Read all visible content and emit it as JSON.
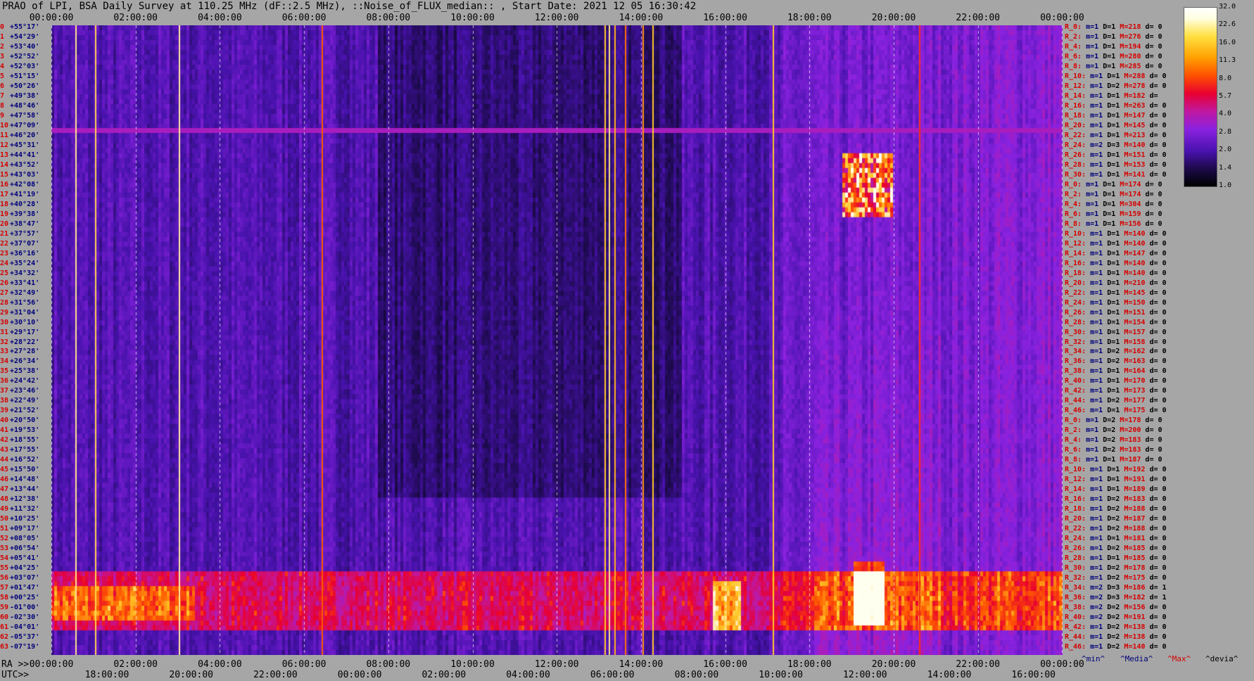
{
  "title": "PRAO of LPI, BSA Daily Survey at 110.25 MHz (dF::2.5 MHz), ::Noise_of_FLUX_median:: , Start Date: 2021 12 05 16:30:42",
  "top_axis": [
    "00:00:00",
    "02:00:00",
    "04:00:00",
    "06:00:00",
    "08:00:00",
    "10:00:00",
    "12:00:00",
    "14:00:00",
    "16:00:00",
    "18:00:00",
    "20:00:00",
    "22:00:00",
    "00:00:00"
  ],
  "ra_label": "RA >>",
  "utc_label": "UTC>>",
  "ra_axis": [
    "00:00:00",
    "02:00:00",
    "04:00:00",
    "06:00:00",
    "08:00:00",
    "10:00:00",
    "12:00:00",
    "14:00:00",
    "16:00:00",
    "18:00:00",
    "20:00:00",
    "22:00:00",
    "00:00:00"
  ],
  "utc_axis": [
    "18:00:00",
    "20:00:00",
    "22:00:00",
    "00:00:00",
    "02:00:00",
    "04:00:00",
    "06:00:00",
    "08:00:00",
    "10:00:00",
    "12:00:00",
    "14:00:00",
    "16:00:00"
  ],
  "colorbar": {
    "ticks": [
      "32.0",
      "22.6",
      "16.0",
      "11.3",
      "8.0",
      "5.7",
      "4.0",
      "2.8",
      "2.0",
      "1.4",
      "1.0"
    ]
  },
  "footer": {
    "min": "^min^",
    "media": "^Media^",
    "max": "^Max^",
    "devia": "^devia^"
  },
  "chart_data": {
    "type": "heatmap",
    "title": "PRAO of LPI, BSA Daily Survey at 110.25 MHz (dF::2.5 MHz), ::Noise_of_FLUX_median:: , Start Date: 2021 12 05 16:30:42",
    "x_top_ticks": [
      "00:00:00",
      "02:00:00",
      "04:00:00",
      "06:00:00",
      "08:00:00",
      "10:00:00",
      "12:00:00",
      "14:00:00",
      "16:00:00",
      "18:00:00",
      "20:00:00",
      "22:00:00",
      "00:00:00"
    ],
    "x_bottom_ra_ticks": [
      "00:00:00",
      "02:00:00",
      "04:00:00",
      "06:00:00",
      "08:00:00",
      "10:00:00",
      "12:00:00",
      "14:00:00",
      "16:00:00",
      "18:00:00",
      "20:00:00",
      "22:00:00",
      "00:00:00"
    ],
    "x_bottom_utc_ticks": [
      "18:00:00",
      "20:00:00",
      "22:00:00",
      "00:00:00",
      "02:00:00",
      "04:00:00",
      "06:00:00",
      "08:00:00",
      "10:00:00",
      "12:00:00",
      "14:00:00",
      "16:00:00"
    ],
    "colorbar_range": [
      1.0,
      32.0
    ],
    "rows": [
      {
        "n": "0",
        "dec": "+55°17'"
      },
      {
        "n": "1",
        "dec": "+54°29'"
      },
      {
        "n": "2",
        "dec": "+53°40'"
      },
      {
        "n": "3",
        "dec": "+52°52'"
      },
      {
        "n": "4",
        "dec": "+52°03'"
      },
      {
        "n": "5",
        "dec": "+51°15'"
      },
      {
        "n": "6",
        "dec": "+50°26'"
      },
      {
        "n": "7",
        "dec": "+49°38'"
      },
      {
        "n": "8",
        "dec": "+48°46'"
      },
      {
        "n": "9",
        "dec": "+47°58'"
      },
      {
        "n": "10",
        "dec": "+47°09'"
      },
      {
        "n": "11",
        "dec": "+46°20'"
      },
      {
        "n": "12",
        "dec": "+45°31'"
      },
      {
        "n": "13",
        "dec": "+44°41'"
      },
      {
        "n": "14",
        "dec": "+43°52'"
      },
      {
        "n": "15",
        "dec": "+43°03'"
      },
      {
        "n": "16",
        "dec": "+42°08'"
      },
      {
        "n": "17",
        "dec": "+41°19'"
      },
      {
        "n": "18",
        "dec": "+40°28'"
      },
      {
        "n": "19",
        "dec": "+39°38'"
      },
      {
        "n": "20",
        "dec": "+38°47'"
      },
      {
        "n": "21",
        "dec": "+37°57'"
      },
      {
        "n": "22",
        "dec": "+37°07'"
      },
      {
        "n": "23",
        "dec": "+36°16'"
      },
      {
        "n": "24",
        "dec": "+35°24'"
      },
      {
        "n": "25",
        "dec": "+34°32'"
      },
      {
        "n": "26",
        "dec": "+33°41'"
      },
      {
        "n": "27",
        "dec": "+32°49'"
      },
      {
        "n": "28",
        "dec": "+31°56'"
      },
      {
        "n": "29",
        "dec": "+31°04'"
      },
      {
        "n": "30",
        "dec": "+30°10'"
      },
      {
        "n": "31",
        "dec": "+29°17'"
      },
      {
        "n": "32",
        "dec": "+28°22'"
      },
      {
        "n": "33",
        "dec": "+27°28'"
      },
      {
        "n": "34",
        "dec": "+26°34'"
      },
      {
        "n": "35",
        "dec": "+25°38'"
      },
      {
        "n": "36",
        "dec": "+24°42'"
      },
      {
        "n": "37",
        "dec": "+23°46'"
      },
      {
        "n": "38",
        "dec": "+22°49'"
      },
      {
        "n": "39",
        "dec": "+21°52'"
      },
      {
        "n": "40",
        "dec": "+20°50'"
      },
      {
        "n": "41",
        "dec": "+19°53'"
      },
      {
        "n": "42",
        "dec": "+18°55'"
      },
      {
        "n": "43",
        "dec": "+17°55'"
      },
      {
        "n": "44",
        "dec": "+16°52'"
      },
      {
        "n": "45",
        "dec": "+15°50'"
      },
      {
        "n": "46",
        "dec": "+14°48'"
      },
      {
        "n": "47",
        "dec": "+13°44'"
      },
      {
        "n": "48",
        "dec": "+12°38'"
      },
      {
        "n": "49",
        "dec": "+11°32'"
      },
      {
        "n": "50",
        "dec": "+10°25'"
      },
      {
        "n": "51",
        "dec": "+09°17'"
      },
      {
        "n": "52",
        "dec": "+08°05'"
      },
      {
        "n": "53",
        "dec": "+06°54'"
      },
      {
        "n": "54",
        "dec": "+05°41'"
      },
      {
        "n": "55",
        "dec": "+04°25'"
      },
      {
        "n": "56",
        "dec": "+03°07'"
      },
      {
        "n": "57",
        "dec": "+01°47'"
      },
      {
        "n": "58",
        "dec": "+00°25'"
      },
      {
        "n": "59",
        "dec": "-01°00'"
      },
      {
        "n": "60",
        "dec": "-02°30'"
      },
      {
        "n": "61",
        "dec": "-04°01'"
      },
      {
        "n": "62",
        "dec": "-05°37'"
      },
      {
        "n": "63",
        "dec": "-07°19'"
      }
    ],
    "stats": [
      {
        "r": "R_0:",
        "m": "1",
        "D": "1",
        "M": "218",
        "d": "0"
      },
      {
        "r": "R_2:",
        "m": "1",
        "D": "1",
        "M": "276",
        "d": "0"
      },
      {
        "r": "R_4:",
        "m": "1",
        "D": "1",
        "M": "194",
        "d": "0"
      },
      {
        "r": "R_6:",
        "m": "1",
        "D": "1",
        "M": "280",
        "d": "0"
      },
      {
        "r": "R_8:",
        "m": "1",
        "D": "1",
        "M": "285",
        "d": "0"
      },
      {
        "r": "R_10:",
        "m": "1",
        "D": "1",
        "M": "288",
        "d": "0"
      },
      {
        "r": "R_12:",
        "m": "1",
        "D": "2",
        "M": "278",
        "d": "0"
      },
      {
        "r": "R_14:",
        "m": "1",
        "D": "1",
        "M": "182",
        "d": ""
      },
      {
        "r": "R_16:",
        "m": "1",
        "D": "1",
        "M": "263",
        "d": "0"
      },
      {
        "r": "R_18:",
        "m": "1",
        "D": "1",
        "M": "147",
        "d": "0"
      },
      {
        "r": "R_20:",
        "m": "1",
        "D": "1",
        "M": "145",
        "d": "0"
      },
      {
        "r": "R_22:",
        "m": "1",
        "D": "1",
        "M": "213",
        "d": "0"
      },
      {
        "r": "R_24:",
        "m": "2",
        "D": "3",
        "M": "140",
        "d": "0"
      },
      {
        "r": "R_26:",
        "m": "1",
        "D": "1",
        "M": "151",
        "d": "0"
      },
      {
        "r": "R_28:",
        "m": "1",
        "D": "1",
        "M": "153",
        "d": "0"
      },
      {
        "r": "R_30:",
        "m": "1",
        "D": "1",
        "M": "141",
        "d": "0"
      },
      {
        "r": "R_0:",
        "m": "1",
        "D": "1",
        "M": "174",
        "d": "0"
      },
      {
        "r": "R_2:",
        "m": "1",
        "D": "1",
        "M": "174",
        "d": "0"
      },
      {
        "r": "R_4:",
        "m": "1",
        "D": "1",
        "M": "304",
        "d": "0"
      },
      {
        "r": "R_6:",
        "m": "1",
        "D": "1",
        "M": "159",
        "d": "0"
      },
      {
        "r": "R_8:",
        "m": "1",
        "D": "1",
        "M": "156",
        "d": "0"
      },
      {
        "r": "R_10:",
        "m": "1",
        "D": "1",
        "M": "140",
        "d": "0"
      },
      {
        "r": "R_12:",
        "m": "1",
        "D": "1",
        "M": "140",
        "d": "0"
      },
      {
        "r": "R_14:",
        "m": "1",
        "D": "1",
        "M": "147",
        "d": "0"
      },
      {
        "r": "R_16:",
        "m": "1",
        "D": "1",
        "M": "140",
        "d": "0"
      },
      {
        "r": "R_18:",
        "m": "1",
        "D": "1",
        "M": "140",
        "d": "0"
      },
      {
        "r": "R_20:",
        "m": "1",
        "D": "1",
        "M": "210",
        "d": "0"
      },
      {
        "r": "R_22:",
        "m": "1",
        "D": "1",
        "M": "145",
        "d": "0"
      },
      {
        "r": "R_24:",
        "m": "1",
        "D": "1",
        "M": "150",
        "d": "0"
      },
      {
        "r": "R_26:",
        "m": "1",
        "D": "1",
        "M": "151",
        "d": "0"
      },
      {
        "r": "R_28:",
        "m": "1",
        "D": "1",
        "M": "154",
        "d": "0"
      },
      {
        "r": "R_30:",
        "m": "1",
        "D": "1",
        "M": "157",
        "d": "0"
      },
      {
        "r": "R_32:",
        "m": "1",
        "D": "1",
        "M": "158",
        "d": "0"
      },
      {
        "r": "R_34:",
        "m": "1",
        "D": "2",
        "M": "162",
        "d": "0"
      },
      {
        "r": "R_36:",
        "m": "1",
        "D": "2",
        "M": "163",
        "d": "0"
      },
      {
        "r": "R_38:",
        "m": "1",
        "D": "1",
        "M": "164",
        "d": "0"
      },
      {
        "r": "R_40:",
        "m": "1",
        "D": "1",
        "M": "170",
        "d": "0"
      },
      {
        "r": "R_42:",
        "m": "1",
        "D": "1",
        "M": "173",
        "d": "0"
      },
      {
        "r": "R_44:",
        "m": "1",
        "D": "2",
        "M": "177",
        "d": "0"
      },
      {
        "r": "R_46:",
        "m": "1",
        "D": "1",
        "M": "175",
        "d": "0"
      },
      {
        "r": "R_0:",
        "m": "1",
        "D": "2",
        "M": "178",
        "d": "0"
      },
      {
        "r": "R_2:",
        "m": "1",
        "D": "2",
        "M": "200",
        "d": "0"
      },
      {
        "r": "R_4:",
        "m": "1",
        "D": "2",
        "M": "183",
        "d": "0"
      },
      {
        "r": "R_6:",
        "m": "1",
        "D": "2",
        "M": "183",
        "d": "0"
      },
      {
        "r": "R_8:",
        "m": "1",
        "D": "1",
        "M": "187",
        "d": "0"
      },
      {
        "r": "R_10:",
        "m": "1",
        "D": "1",
        "M": "192",
        "d": "0"
      },
      {
        "r": "R_12:",
        "m": "1",
        "D": "1",
        "M": "191",
        "d": "0"
      },
      {
        "r": "R_14:",
        "m": "1",
        "D": "1",
        "M": "189",
        "d": "0"
      },
      {
        "r": "R_16:",
        "m": "1",
        "D": "2",
        "M": "183",
        "d": "0"
      },
      {
        "r": "R_18:",
        "m": "1",
        "D": "2",
        "M": "188",
        "d": "0"
      },
      {
        "r": "R_20:",
        "m": "1",
        "D": "2",
        "M": "187",
        "d": "0"
      },
      {
        "r": "R_22:",
        "m": "1",
        "D": "2",
        "M": "188",
        "d": "0"
      },
      {
        "r": "R_24:",
        "m": "1",
        "D": "1",
        "M": "181",
        "d": "0"
      },
      {
        "r": "R_26:",
        "m": "1",
        "D": "2",
        "M": "185",
        "d": "0"
      },
      {
        "r": "R_28:",
        "m": "1",
        "D": "1",
        "M": "185",
        "d": "0"
      },
      {
        "r": "R_30:",
        "m": "1",
        "D": "2",
        "M": "178",
        "d": "0"
      },
      {
        "r": "R_32:",
        "m": "1",
        "D": "2",
        "M": "175",
        "d": "0"
      },
      {
        "r": "R_34:",
        "m": "2",
        "D": "3",
        "M": "186",
        "d": "1"
      },
      {
        "r": "R_36:",
        "m": "2",
        "D": "3",
        "M": "182",
        "d": "1"
      },
      {
        "r": "R_38:",
        "m": "2",
        "D": "2",
        "M": "156",
        "d": "0"
      },
      {
        "r": "R_40:",
        "m": "2",
        "D": "2",
        "M": "191",
        "d": "0"
      },
      {
        "r": "R_42:",
        "m": "1",
        "D": "2",
        "M": "138",
        "d": "0"
      },
      {
        "r": "R_44:",
        "m": "1",
        "D": "2",
        "M": "138",
        "d": "0"
      },
      {
        "r": "R_46:",
        "m": "1",
        "D": "2",
        "M": "140",
        "d": "0"
      }
    ]
  }
}
